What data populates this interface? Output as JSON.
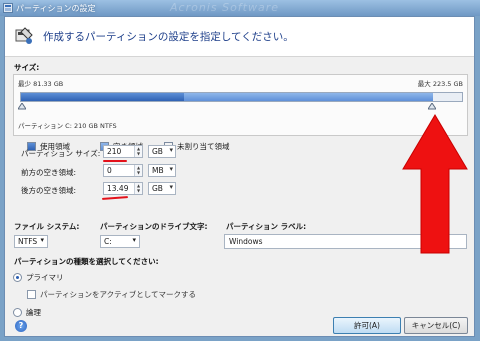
{
  "window": {
    "title": "パーティションの設定",
    "background_text": "Acronis Software"
  },
  "header": {
    "heading": "作成するパーティションの設定を指定してください。"
  },
  "size_section": {
    "label": "サイズ:",
    "min_label": "最少 81.33 GB",
    "max_label": "最大 223.5 GB",
    "partition_info": "パーティション C:  210 GB  NTFS",
    "used_fraction": 0.37,
    "partition_fraction": 0.935
  },
  "legend": {
    "used": "使用領域",
    "free": "空き領域",
    "unallocated": "未割り当て領域"
  },
  "fields": {
    "partition_size": {
      "label": "パーティション サイズ:",
      "value": "210",
      "unit": "GB"
    },
    "free_before": {
      "label": "前方の空き領域:",
      "value": "0",
      "unit": "MB"
    },
    "free_after": {
      "label": "後方の空き領域:",
      "value": "13.49",
      "unit": "GB"
    }
  },
  "filesystem": {
    "label": "ファイル システム:",
    "value": "NTFS"
  },
  "drive_letter": {
    "label": "パーティションのドライブ文字:",
    "value": "C:"
  },
  "partition_label": {
    "label": "パーティション ラベル:",
    "value": "Windows"
  },
  "partition_type": {
    "label": "パーティションの種類を選択してください:",
    "primary": "プライマリ",
    "active_checkbox": "パーティションをアクティブとしてマークする",
    "logical": "論理",
    "selected": "primary"
  },
  "buttons": {
    "help": "?",
    "ok": "許可(A)",
    "cancel": "キャンセル(C)"
  },
  "colors": {
    "annotation_red": "#e3111a",
    "heading_blue": "#1e3f8a",
    "used_blue": "#2f62b4",
    "free_blue": "#8fb7ea"
  }
}
